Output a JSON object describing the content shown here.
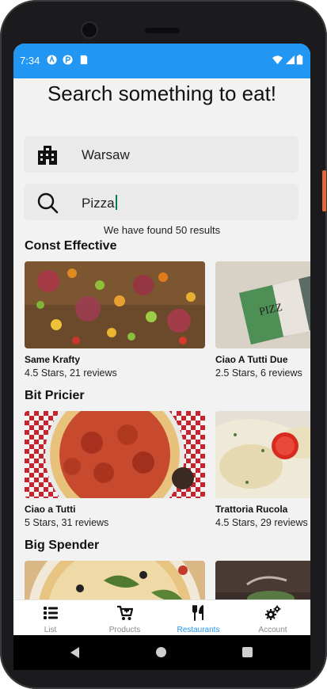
{
  "status_bar": {
    "time": "7:34"
  },
  "page": {
    "title": "Search something to eat!",
    "city": {
      "value": "Warsaw"
    },
    "search": {
      "value": "Pizza"
    },
    "results_text": "We have found 50 results"
  },
  "sections": [
    {
      "title": "Const Effective",
      "cards": [
        {
          "name": "Same Krafty",
          "rating": "4.5 Stars, 21 reviews"
        },
        {
          "name": "Ciao A Tutti Due",
          "rating": "2.5 Stars, 6 reviews"
        }
      ]
    },
    {
      "title": "Bit Pricier",
      "cards": [
        {
          "name": "Ciao a Tutti",
          "rating": "5 Stars, 31 reviews"
        },
        {
          "name": "Trattoria Rucola",
          "rating": "4.5 Stars, 29 reviews"
        }
      ]
    },
    {
      "title": "Big Spender",
      "cards": []
    }
  ],
  "card_image_text": "PIZZ",
  "tabs": [
    {
      "label": "List",
      "icon": "list-icon"
    },
    {
      "label": "Products",
      "icon": "cart-icon"
    },
    {
      "label": "Restaurants",
      "icon": "utensils-icon"
    },
    {
      "label": "Account",
      "icon": "cogs-icon"
    }
  ],
  "active_tab": "Restaurants",
  "colors": {
    "accent": "#2196f3",
    "status_bar": "#2196f3",
    "cursor": "#0b7a5c"
  }
}
